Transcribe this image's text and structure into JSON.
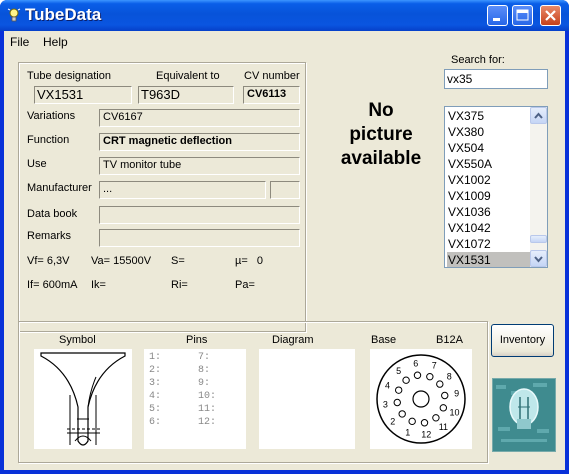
{
  "window": {
    "title": "TubeData"
  },
  "menu": {
    "file": "File",
    "help": "Help"
  },
  "tube": {
    "designation_label": "Tube designation",
    "designation": "VX1531",
    "equivalent_label": "Equivalent to",
    "equivalent": "T963D",
    "cv_label": "CV number",
    "cv": "CV6113",
    "variations_label": "Variations",
    "variations": "CV6167",
    "function_label": "Function",
    "function": "CRT magnetic deflection",
    "use_label": "Use",
    "use": "TV monitor tube",
    "manufacturer_label": "Manufacturer",
    "manufacturer": "...",
    "manufacturer_extra": "",
    "databook_label": "Data book",
    "databook": "",
    "remarks_label": "Remarks",
    "remarks": ""
  },
  "params": {
    "vf": "Vf= 6,3V",
    "va": "Va= 15500V",
    "s": "S=",
    "mu": "µ=   0",
    "if": "If= 600mA",
    "ik": "Ik=",
    "ri": "Ri=",
    "pa": "Pa="
  },
  "picture": {
    "line1": "No",
    "line2": "picture",
    "line3": "available"
  },
  "search": {
    "label": "Search for:",
    "value": "vx35"
  },
  "results": [
    "VX375",
    "VX380",
    "VX504",
    "VX550A",
    "VX1002",
    "VX1009",
    "VX1036",
    "VX1042",
    "VX1072",
    "VX1531"
  ],
  "selected_result": "VX1531",
  "bottom": {
    "symbol_label": "Symbol",
    "pins_label": "Pins",
    "diagram_label": "Diagram",
    "base_label": "Base",
    "base_type": "B12A",
    "pins": [
      "1:",
      "2:",
      "3:",
      "4:",
      "5:",
      "6:",
      "7:",
      "8:",
      "9:",
      "10:",
      "11:",
      "12:"
    ]
  },
  "buttons": {
    "inventory": "Inventory"
  },
  "colors": {
    "title_bar": "#0a5ee8",
    "face": "#ece9d8",
    "selection": "#c1c0bd"
  }
}
